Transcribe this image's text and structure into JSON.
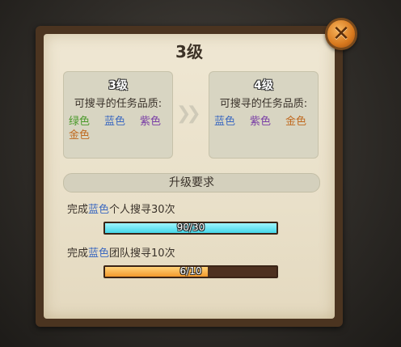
{
  "dialog": {
    "title": "3级",
    "close_icon": "close-icon"
  },
  "current": {
    "level": "3级",
    "label": "可搜寻的任务品质:",
    "qualities": [
      {
        "text": "绿色",
        "color": "#4a9a2a"
      },
      {
        "text": "蓝色",
        "color": "#3c69c0"
      },
      {
        "text": "紫色",
        "color": "#7a3ea6"
      },
      {
        "text": "金色",
        "color": "#c06a20"
      }
    ]
  },
  "next": {
    "level": "4级",
    "label": "可搜寻的任务品质:",
    "qualities": [
      {
        "text": "蓝色",
        "color": "#3c69c0"
      },
      {
        "text": "紫色",
        "color": "#7a3ea6"
      },
      {
        "text": "金色",
        "color": "#c06a20"
      }
    ]
  },
  "arrow_icon": "double-chevron-right-icon",
  "requirements": {
    "heading": "升级要求",
    "tasks": [
      {
        "prefix": "完成",
        "highlight": "蓝色",
        "suffix": "个人搜寻30次",
        "progress_text": "90/30",
        "progress": 1.0,
        "bar_color": "#46d6e8"
      },
      {
        "prefix": "完成",
        "highlight": "蓝色",
        "suffix": "团队搜寻10次",
        "progress_text": "6/10",
        "progress": 0.6,
        "bar_color": "#f49a2c"
      }
    ],
    "highlight_color": "#3c69c0"
  }
}
